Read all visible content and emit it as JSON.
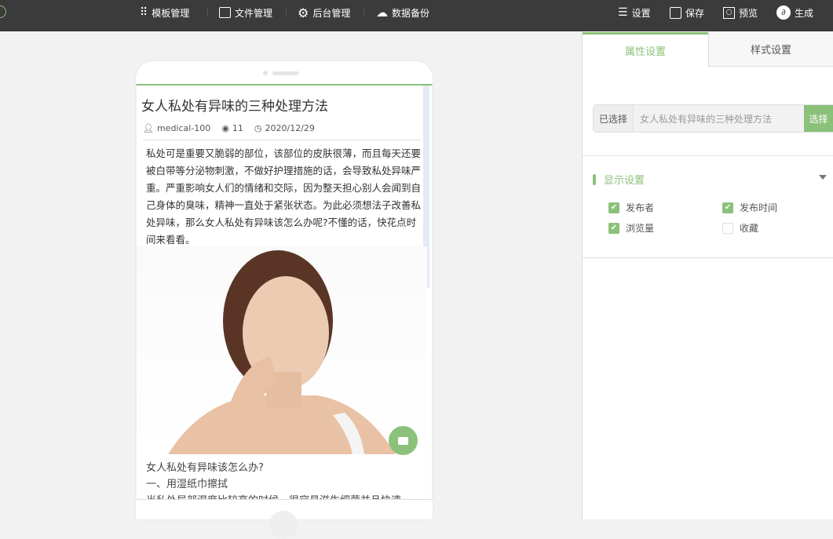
{
  "topbar": {
    "nav": [
      {
        "label": "模板管理",
        "icon": "grid-icon"
      },
      {
        "label": "文件管理",
        "icon": "inbox-icon"
      },
      {
        "label": "后台管理",
        "icon": "gear-icon"
      },
      {
        "label": "数据备份",
        "icon": "cloud-upload-icon"
      }
    ],
    "actions": [
      {
        "label": "设置",
        "icon": "sliders-icon"
      },
      {
        "label": "保存",
        "icon": "save-icon"
      },
      {
        "label": "预览",
        "icon": "preview-icon"
      },
      {
        "label": "生成",
        "icon": "link-icon"
      }
    ]
  },
  "article": {
    "title": "女人私处有异味的三种处理方法",
    "author": "medical-100",
    "views": "11",
    "date": "2020/12/29",
    "body": "私处可是重要又脆弱的部位，该部位的皮肤很薄，而且每天还要被白带等分泌物刺激，不做好护理措施的话，会导致私处异味严重。严重影响女人们的情绪和交际，因为整天担心别人会闻到自己身体的臭味，精神一直处于紧张状态。为此必须想法子改善私处异味，那么女人私处有异味该怎么办呢?不懂的话，快花点时间来看看。",
    "after": [
      "女人私处有异味该怎么办?",
      "一、用湿纸巾擦拭",
      "当私处局部湿度比较高的时候，很容易滋生细菌并且快速"
    ]
  },
  "panel": {
    "tabs": [
      "属性设置",
      "样式设置"
    ],
    "selected_label": "已选择",
    "selected_value": "女人私处有异味的三种处理方法",
    "select_button": "选择",
    "section_title": "显示设置",
    "options": [
      {
        "label": "发布者",
        "checked": true
      },
      {
        "label": "发布时间",
        "checked": true
      },
      {
        "label": "浏览量",
        "checked": true
      },
      {
        "label": "收藏",
        "checked": false
      }
    ]
  },
  "colors": {
    "accent": "#8bc17a",
    "topbar": "#3b3b3b"
  }
}
